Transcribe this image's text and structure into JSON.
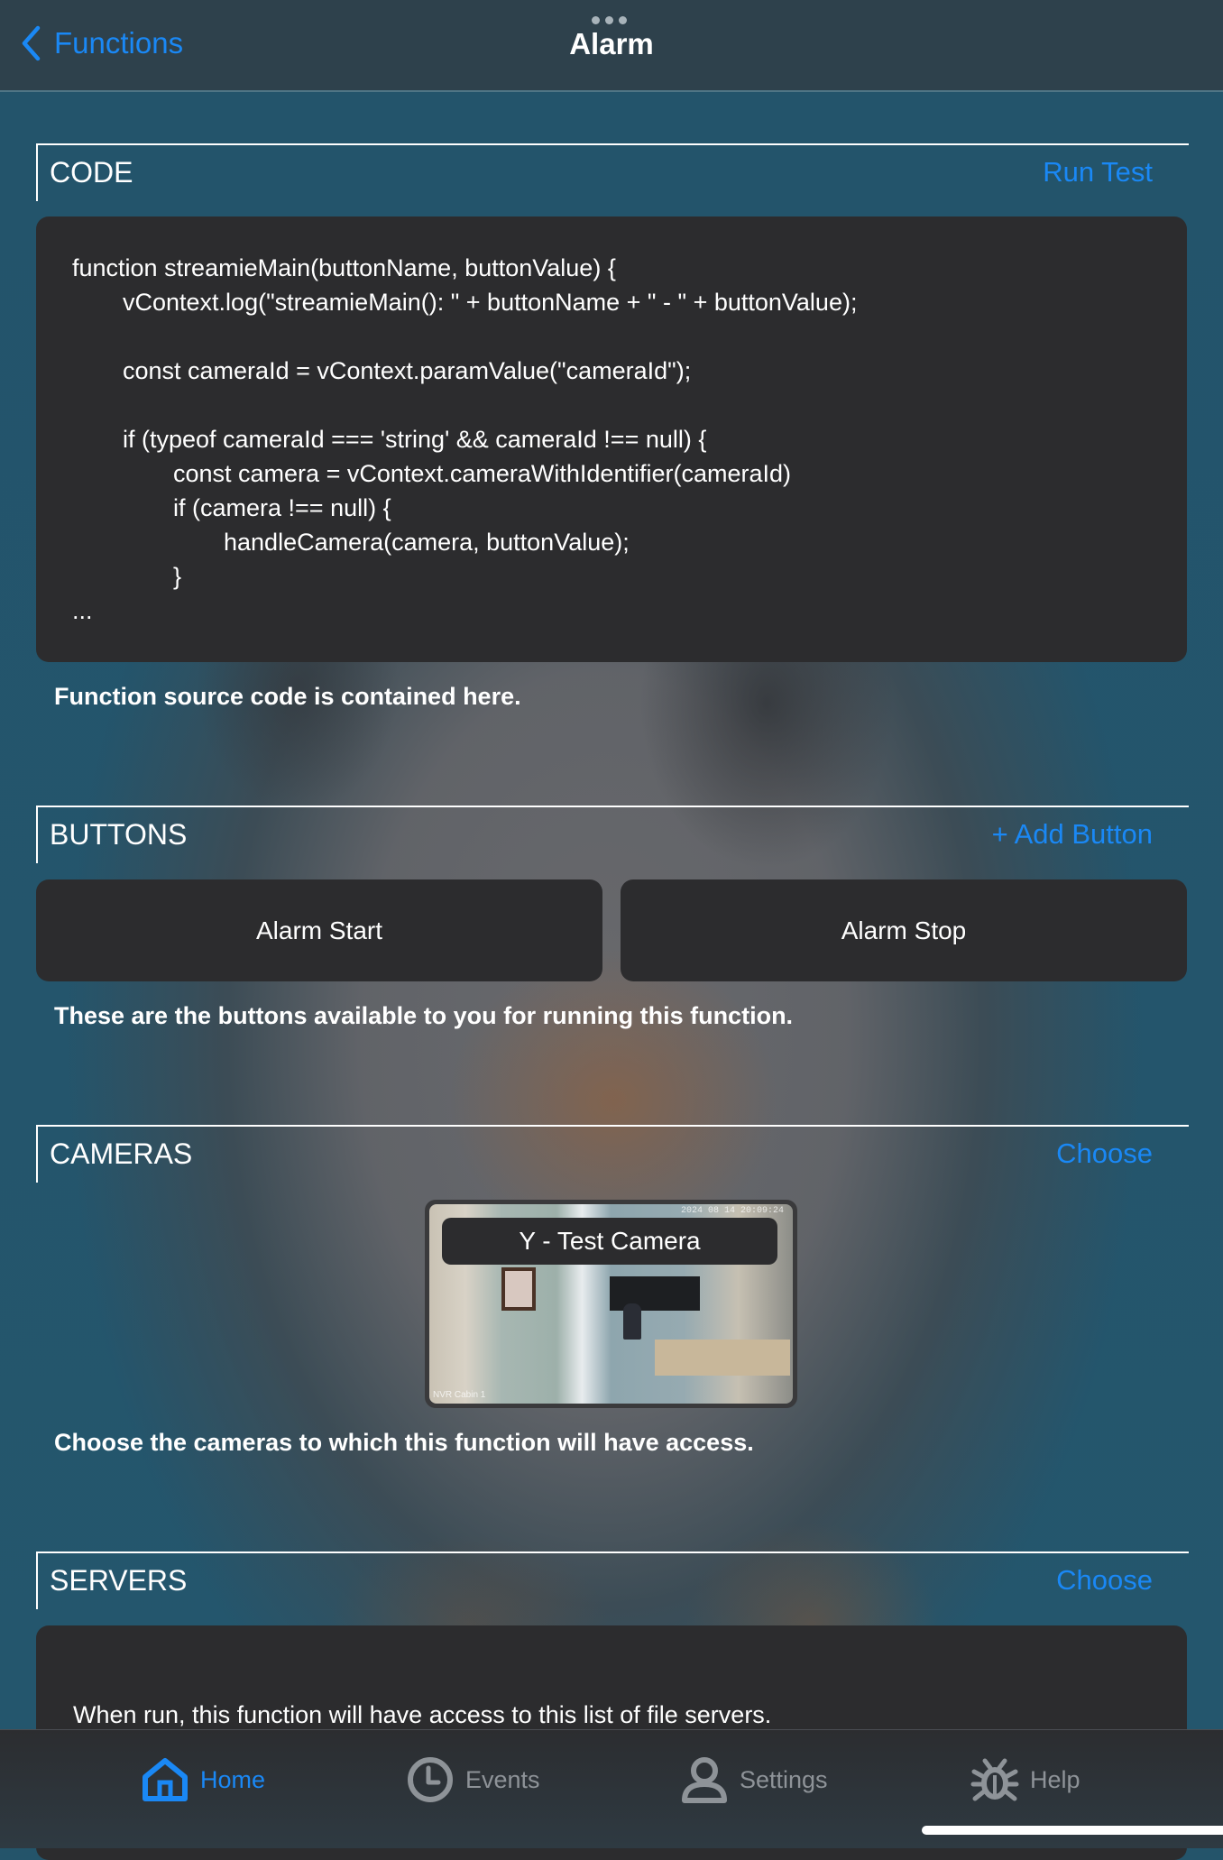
{
  "navbar": {
    "back_label": "Functions",
    "title": "Alarm"
  },
  "sections": {
    "code": {
      "title": "CODE",
      "action": "Run Test",
      "lines": [
        "function streamieMain(buttonName, buttonValue) {",
        "vContext.log(\"streamieMain(): \" + buttonName + \" - \" + buttonValue);",
        "const cameraId = vContext.paramValue(\"cameraId\");",
        "if (typeof cameraId === 'string' && cameraId !== null) {",
        "const camera = vContext.cameraWithIdentifier(cameraId)",
        "if (camera !== null) {",
        "handleCamera(camera, buttonValue);",
        "}",
        "..."
      ],
      "description": "Function source code is contained here."
    },
    "buttons": {
      "title": "BUTTONS",
      "action": "+ Add Button",
      "items": [
        "Alarm Start",
        "Alarm Stop"
      ],
      "description": "These are the buttons available to you for running this function."
    },
    "cameras": {
      "title": "CAMERAS",
      "action": "Choose",
      "items": [
        {
          "label": "Y - Test Camera",
          "timestamp": "2024 08 14 20:09:24",
          "overlay_name": "NVR Cabin 1"
        }
      ],
      "description": "Choose the cameras to which this function will have access."
    },
    "servers": {
      "title": "SERVERS",
      "action": "Choose",
      "description": "When run, this function will have access to this list of file servers."
    }
  },
  "tabbar": {
    "items": [
      {
        "label": "Home",
        "icon": "home-icon",
        "active": true
      },
      {
        "label": "Events",
        "icon": "clock-icon",
        "active": false
      },
      {
        "label": "Settings",
        "icon": "person-icon",
        "active": false
      },
      {
        "label": "Help",
        "icon": "bug-icon",
        "active": false
      }
    ]
  },
  "colors": {
    "accent": "#1a88f5",
    "card": "#2c2c2e",
    "navbar": "#2e414c",
    "inactive_tab": "#8e9398"
  }
}
